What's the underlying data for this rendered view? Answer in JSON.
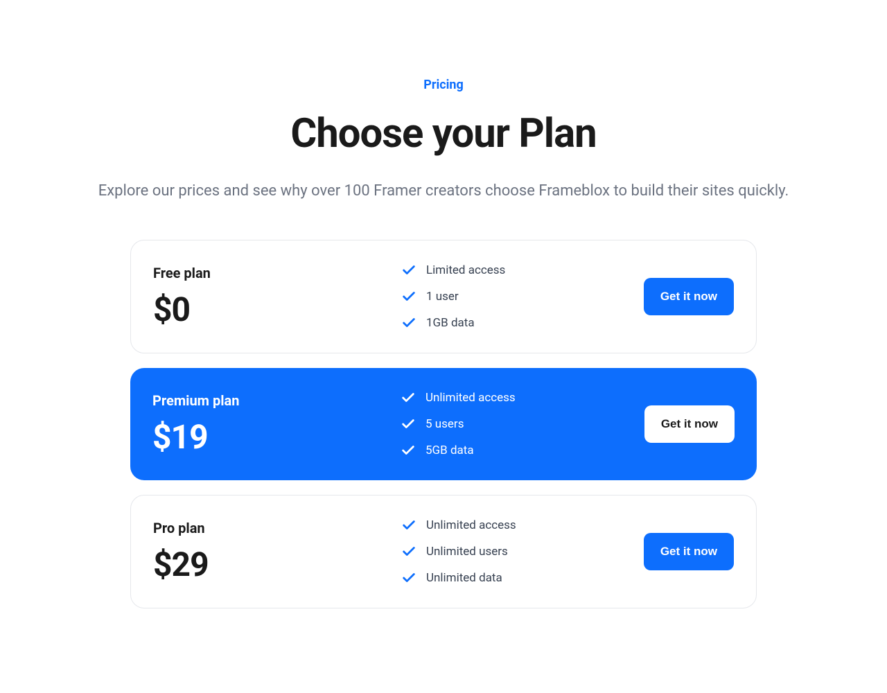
{
  "header": {
    "eyebrow": "Pricing",
    "heading": "Choose your Plan",
    "subheading": "Explore our prices and see why over 100 Framer creators choose Frameblox to build their sites quickly."
  },
  "plans": [
    {
      "name": "Free plan",
      "price": "$0",
      "featured": false,
      "features": [
        "Limited access",
        "1 user",
        "1GB data"
      ],
      "cta": "Get it now"
    },
    {
      "name": "Premium plan",
      "price": "$19",
      "featured": true,
      "features": [
        "Unlimited access",
        "5 users",
        "5GB data"
      ],
      "cta": "Get it now"
    },
    {
      "name": "Pro plan",
      "price": "$29",
      "featured": false,
      "features": [
        "Unlimited access",
        "Unlimited users",
        "Unlimited data"
      ],
      "cta": "Get it now"
    }
  ]
}
